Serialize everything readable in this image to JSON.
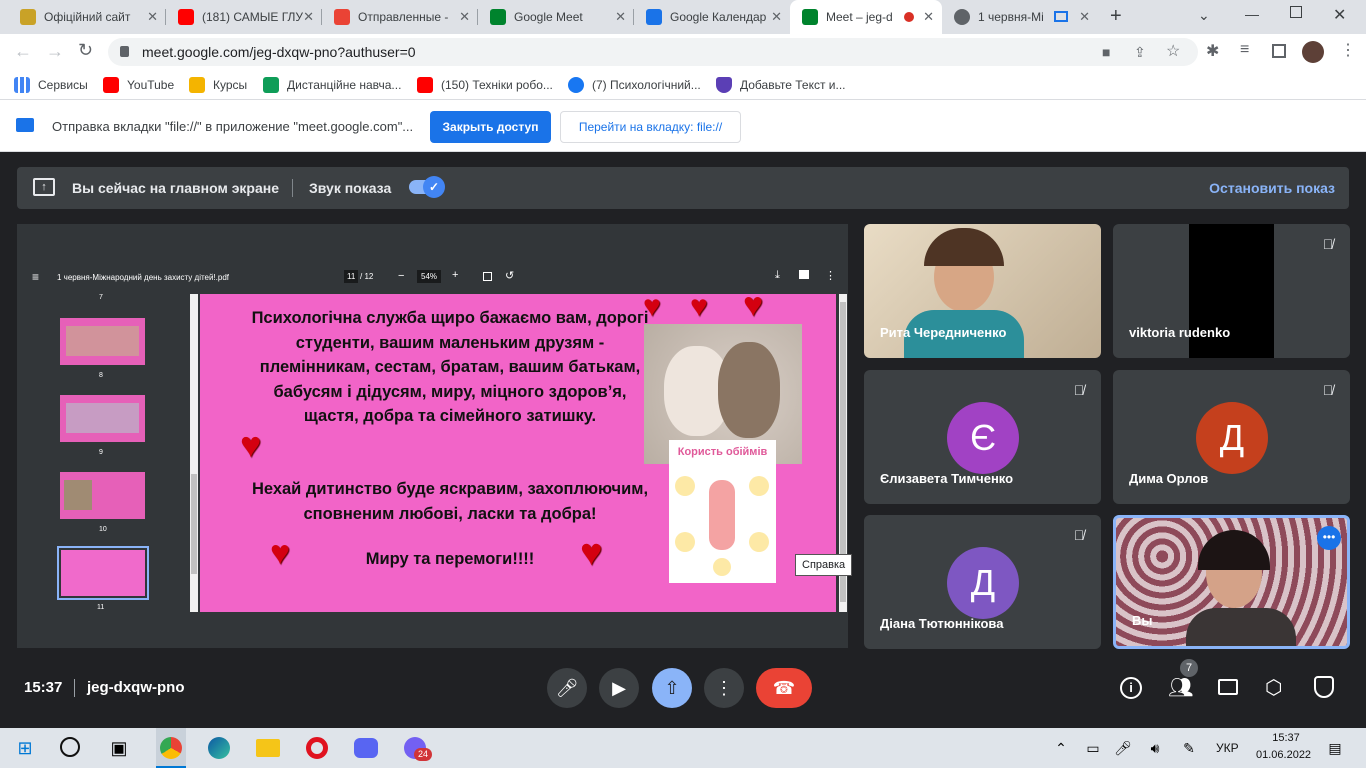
{
  "tabs": [
    {
      "title": "Офіційний сайт ",
      "color": "#c9a227"
    },
    {
      "title": "(181) САМЫЕ ГЛУ",
      "color": "#ff0000"
    },
    {
      "title": "Отправленные - ",
      "color": "#ea4335"
    },
    {
      "title": "Google Meet",
      "color": "#00832d"
    },
    {
      "title": "Google Календар",
      "color": "#1a73e8"
    },
    {
      "title": "Meet – jeg-d",
      "color": "#00832d"
    },
    {
      "title": "1 червня-Мі",
      "color": "#5f6368"
    }
  ],
  "address": {
    "url": "meet.google.com/jeg-dxqw-pno?authuser=0"
  },
  "bookmarks": [
    {
      "label": "Сервисы",
      "color": "#4285f4"
    },
    {
      "label": "YouTube",
      "color": "#ff0000"
    },
    {
      "label": "Курсы",
      "color": "#f4b400"
    },
    {
      "label": "Дистанційне навча...",
      "color": "#0f9d58"
    },
    {
      "label": "(150) Техніки робо...",
      "color": "#ff0000"
    },
    {
      "label": "(7) Психологічний...",
      "color": "#1877f2"
    },
    {
      "label": "Добавьте Текст и...",
      "color": "#5b3fb5"
    }
  ],
  "sharebar": {
    "message": "Отправка вкладки \"file://\" в приложение \"meet.google.com\"...",
    "stop": "Закрыть доступ",
    "goto": "Перейти на вкладку: file://"
  },
  "presenting": {
    "text": "Вы сейчас на главном экране",
    "sound": "Звук показа",
    "stop": "Остановить показ"
  },
  "pdf": {
    "filename": "1 червня-Міжнародний день захисту дітей!.pdf",
    "page": "11",
    "total": "/ 12",
    "zoom": "54%",
    "thumbs": [
      "7",
      "8",
      "9",
      "10",
      "11"
    ],
    "text1": "Психологічна служба щиро бажаємо вам, дорогі студенти, вашим маленьким друзям - племінникам, сестам, братам, вашим батькам, бабусям і дідусям, миру, міцного здоров’я, щастя, добра та сімейного затишку.",
    "text2": "Нехай дитинство буде яскравим, захоплюючим, сповненим любові, ласки та добра!",
    "text3": "Миру та перемоги!!!!",
    "poster": "Користь обіймів",
    "tooltip": "Справка"
  },
  "participants": [
    {
      "name": "Рита Чередниченко",
      "video": true,
      "muted": false
    },
    {
      "name": "viktoria rudenko",
      "video": true,
      "muted": true
    },
    {
      "name": "Єлизавета Тимченко",
      "initial": "Є",
      "color": "#a142c4",
      "muted": true
    },
    {
      "name": "Дима Орлов",
      "initial": "Д",
      "color": "#c5401d",
      "muted": true
    },
    {
      "name": "Діана Тютюннікова",
      "initial": "Д",
      "color": "#7e57c2",
      "muted": true
    },
    {
      "name": "Вы",
      "video": true,
      "self": true
    }
  ],
  "meeting": {
    "time": "15:37",
    "code": "jeg-dxqw-pno",
    "people_count": "7"
  },
  "taskbar": {
    "lang": "УКР",
    "time": "15:37",
    "date": "01.06.2022",
    "badge": "24"
  }
}
